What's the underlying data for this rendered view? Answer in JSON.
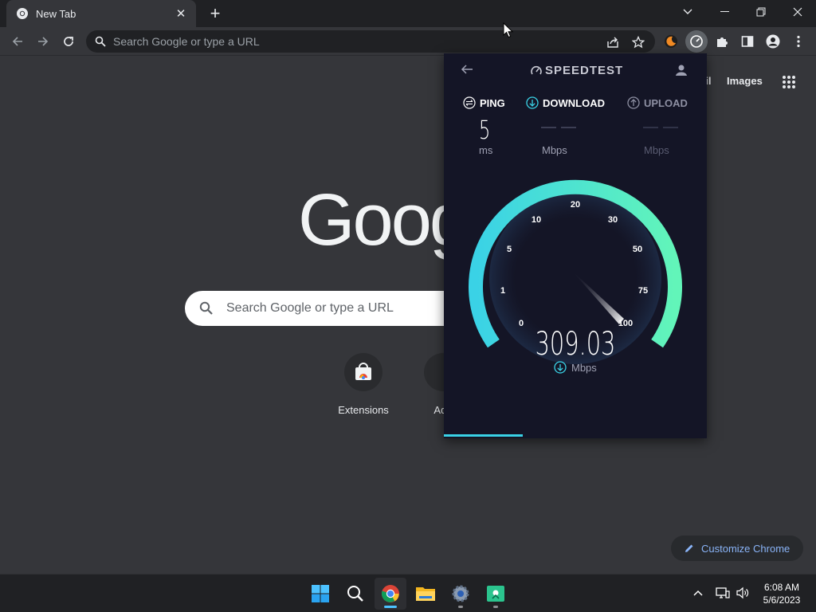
{
  "browser": {
    "tab": {
      "title": "New Tab"
    },
    "omnibox": {
      "placeholder": "Search Google or type a URL"
    }
  },
  "ntp": {
    "links": {
      "gmail_partial": "ail",
      "images": "Images"
    },
    "logo_partial": "Goog",
    "search": {
      "placeholder": "Search Google or type a URL"
    },
    "shortcuts": [
      {
        "label": "Extensions"
      },
      {
        "label": "Add"
      }
    ],
    "customize_label": "Customize Chrome"
  },
  "speedtest": {
    "brand": "SPEEDTEST",
    "metrics": {
      "ping": {
        "label": "PING",
        "value": "5",
        "unit": "ms"
      },
      "download": {
        "label": "DOWNLOAD",
        "value": "— —",
        "unit": "Mbps"
      },
      "upload": {
        "label": "UPLOAD",
        "value": "— —",
        "unit": "Mbps"
      }
    },
    "gauge": {
      "ticks": [
        "0",
        "1",
        "5",
        "10",
        "20",
        "30",
        "50",
        "75",
        "100"
      ],
      "needle_value": "100"
    },
    "current_speed": "309.03",
    "current_unit": "Mbps",
    "progress": 0.3
  },
  "taskbar": {
    "apps": [
      "start-icon",
      "search-icon",
      "chrome-icon",
      "file-explorer-icon",
      "settings-icon",
      "snipping-tool-icon"
    ],
    "active_app": "chrome-icon"
  },
  "clock": {
    "time": "6:08 AM",
    "date": "5/6/2023"
  },
  "colors": {
    "accent_blue": "#8ab4f8",
    "gauge_start": "#3ad2e6",
    "gauge_end": "#62f5b9",
    "speedtest_bg": "#141526"
  }
}
